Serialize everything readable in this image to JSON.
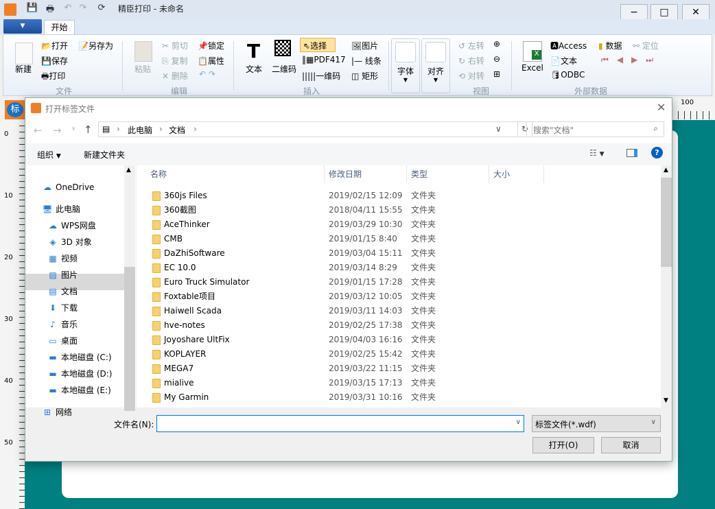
{
  "app": {
    "title": "精臣打印 - 未命名",
    "tab": "开始",
    "logo_char": "标"
  },
  "ribbon": {
    "file": {
      "new": "新建",
      "open": "打开",
      "save_as": "另存为",
      "save": "保存",
      "print": "打印",
      "group": "文件"
    },
    "edit": {
      "paste": "粘贴",
      "cut": "剪切",
      "copy": "复制",
      "delete": "删除",
      "lock": "锁定",
      "props": "属性",
      "group": "编辑"
    },
    "insert": {
      "text": "文本",
      "qrcode": "二维码",
      "select": "选择",
      "pdf417": "PDF417",
      "barcode": "一维码",
      "image": "图片",
      "line": "线条",
      "rect": "矩形",
      "group": "插入"
    },
    "font": "字体",
    "align": "对齐",
    "view": {
      "rot_left": "左转",
      "rot_right": "右转",
      "flip": "对转",
      "group": "视图"
    },
    "ext": {
      "excel": "Excel",
      "access": "Access",
      "text": "文本",
      "odbc": "ODBC",
      "data": "数据",
      "locate": "定位",
      "group": "外部数据"
    }
  },
  "ruler": {
    "top": "100",
    "left": [
      "0",
      "10",
      "20",
      "30",
      "40",
      "50"
    ]
  },
  "dialog": {
    "title": "打开标签文件",
    "breadcrumb": [
      "此电脑",
      "文档"
    ],
    "search_placeholder": "搜索\"文档\"",
    "organize": "组织",
    "new_folder": "新建文件夹",
    "nav": [
      {
        "label": "OneDrive",
        "icon": "☁"
      },
      {
        "label": "此电脑",
        "icon": "🖥"
      },
      {
        "label": "WPS网盘",
        "icon": "☁"
      },
      {
        "label": "3D 对象",
        "icon": "◈"
      },
      {
        "label": "视频",
        "icon": "▦"
      },
      {
        "label": "图片",
        "icon": "▨"
      },
      {
        "label": "文档",
        "icon": "▤"
      },
      {
        "label": "下载",
        "icon": "⬇"
      },
      {
        "label": "音乐",
        "icon": "♪"
      },
      {
        "label": "桌面",
        "icon": "▭"
      },
      {
        "label": "本地磁盘 (C:)",
        "icon": "▬"
      },
      {
        "label": "本地磁盘 (D:)",
        "icon": "▬"
      },
      {
        "label": "本地磁盘 (E:)",
        "icon": "▬"
      },
      {
        "label": "网络",
        "icon": "⊞"
      }
    ],
    "columns": [
      "名称",
      "修改日期",
      "类型",
      "大小"
    ],
    "files": [
      {
        "name": "360js Files",
        "date": "2019/02/15 12:09",
        "type": "文件夹"
      },
      {
        "name": "360截图",
        "date": "2018/04/11 15:55",
        "type": "文件夹"
      },
      {
        "name": "AceThinker",
        "date": "2019/03/29 10:30",
        "type": "文件夹"
      },
      {
        "name": "CMB",
        "date": "2019/01/15 8:40",
        "type": "文件夹"
      },
      {
        "name": "DaZhiSoftware",
        "date": "2019/03/04 15:11",
        "type": "文件夹"
      },
      {
        "name": "EC 10.0",
        "date": "2019/03/14 8:29",
        "type": "文件夹"
      },
      {
        "name": "Euro Truck Simulator",
        "date": "2019/01/15 17:28",
        "type": "文件夹"
      },
      {
        "name": "Foxtable项目",
        "date": "2019/03/12 10:05",
        "type": "文件夹"
      },
      {
        "name": "Haiwell Scada",
        "date": "2019/03/11 14:03",
        "type": "文件夹"
      },
      {
        "name": "hve-notes",
        "date": "2019/02/25 17:38",
        "type": "文件夹"
      },
      {
        "name": "Joyoshare UltFix",
        "date": "2019/04/03 16:16",
        "type": "文件夹"
      },
      {
        "name": "KOPLAYER",
        "date": "2019/02/25 15:42",
        "type": "文件夹"
      },
      {
        "name": "MEGA7",
        "date": "2019/03/22 11:15",
        "type": "文件夹"
      },
      {
        "name": "mialive",
        "date": "2019/03/15 17:13",
        "type": "文件夹"
      },
      {
        "name": "My Garmin",
        "date": "2019/03/31 10:16",
        "type": "文件夹"
      }
    ],
    "filename_label": "文件名(N):",
    "filename_value": "",
    "filter": "标签文件(*.wdf)",
    "open": "打开(O)",
    "cancel": "取消"
  }
}
